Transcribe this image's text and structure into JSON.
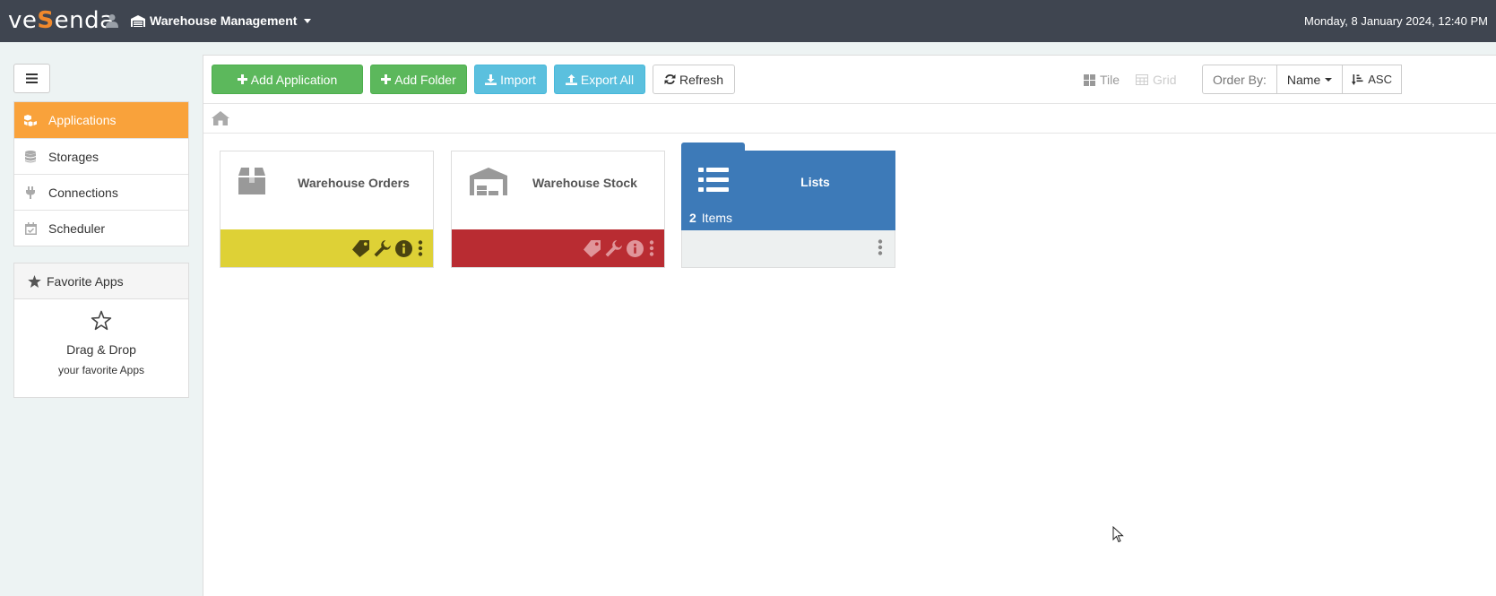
{
  "header": {
    "logo_pre": "ve",
    "logo_accent": "S",
    "logo_post": "enda",
    "context": "Warehouse Management",
    "datetime": "Monday, 8 January 2024, 12:40 PM",
    "background": "#3f4550"
  },
  "sidebar": {
    "items": [
      {
        "label": "Applications",
        "icon": "cubes-icon",
        "active": true
      },
      {
        "label": "Storages",
        "icon": "database-icon"
      },
      {
        "label": "Connections",
        "icon": "plug-icon"
      },
      {
        "label": "Scheduler",
        "icon": "calendar-check-icon"
      }
    ],
    "favorites": {
      "title": "Favorite Apps",
      "hint_title": "Drag & Drop",
      "hint_sub": "your favorite Apps"
    },
    "active_color": "#f9a23b"
  },
  "toolbar": {
    "add_application": "Add Application",
    "add_folder": "Add Folder",
    "import": "Import",
    "export_all": "Export All",
    "refresh": "Refresh"
  },
  "view": {
    "tile": "Tile",
    "grid": "Grid",
    "order_by_label": "Order By:",
    "order_by_value": "Name",
    "order_dir": "ASC"
  },
  "tiles": [
    {
      "title": "Warehouse Orders",
      "icon": "box-icon",
      "footer_color": "#ded136"
    },
    {
      "title": "Warehouse Stock",
      "icon": "warehouse-icon",
      "footer_color": "#b92c32"
    }
  ],
  "folder": {
    "title": "Lists",
    "count": "2",
    "count_label": "Items",
    "color": "#3d7ab8"
  }
}
